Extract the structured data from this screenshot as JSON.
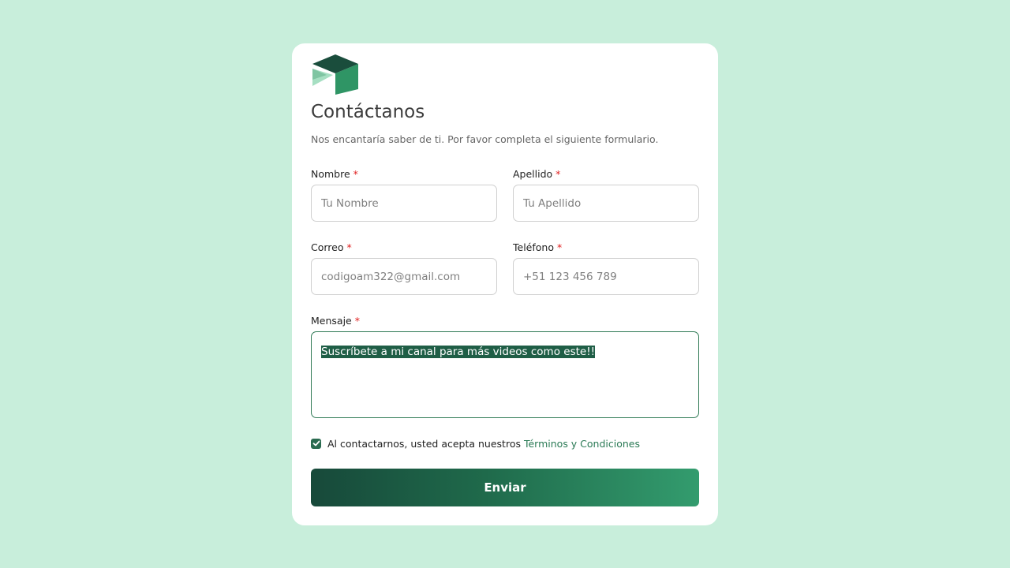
{
  "form": {
    "title": "Contáctanos",
    "subtitle": "Nos encantaría saber de ti. Por favor completa el siguiente formulario.",
    "required_mark": "*",
    "first_name": {
      "label": "Nombre",
      "placeholder": "Tu Nombre",
      "value": ""
    },
    "last_name": {
      "label": "Apellido",
      "placeholder": "Tu Apellido",
      "value": ""
    },
    "email": {
      "label": "Correo",
      "placeholder": "codigoam322@gmail.com",
      "value": ""
    },
    "phone": {
      "label": "Teléfono",
      "placeholder": "+51 123 456 789",
      "value": ""
    },
    "message": {
      "label": "Mensaje",
      "value": "Suscríbete a mi canal para más videos como este!!"
    },
    "terms": {
      "text": "Al contactarnos, usted acepta nuestros",
      "link": "Términos y Condiciones",
      "checked": true
    },
    "submit_label": "Enviar"
  },
  "colors": {
    "background": "#c8eedb",
    "accent": "#2a6b50",
    "link": "#2a7a55",
    "required": "#e02020"
  },
  "icons": {
    "logo": "box-logo-icon",
    "checkbox": "check-icon"
  }
}
